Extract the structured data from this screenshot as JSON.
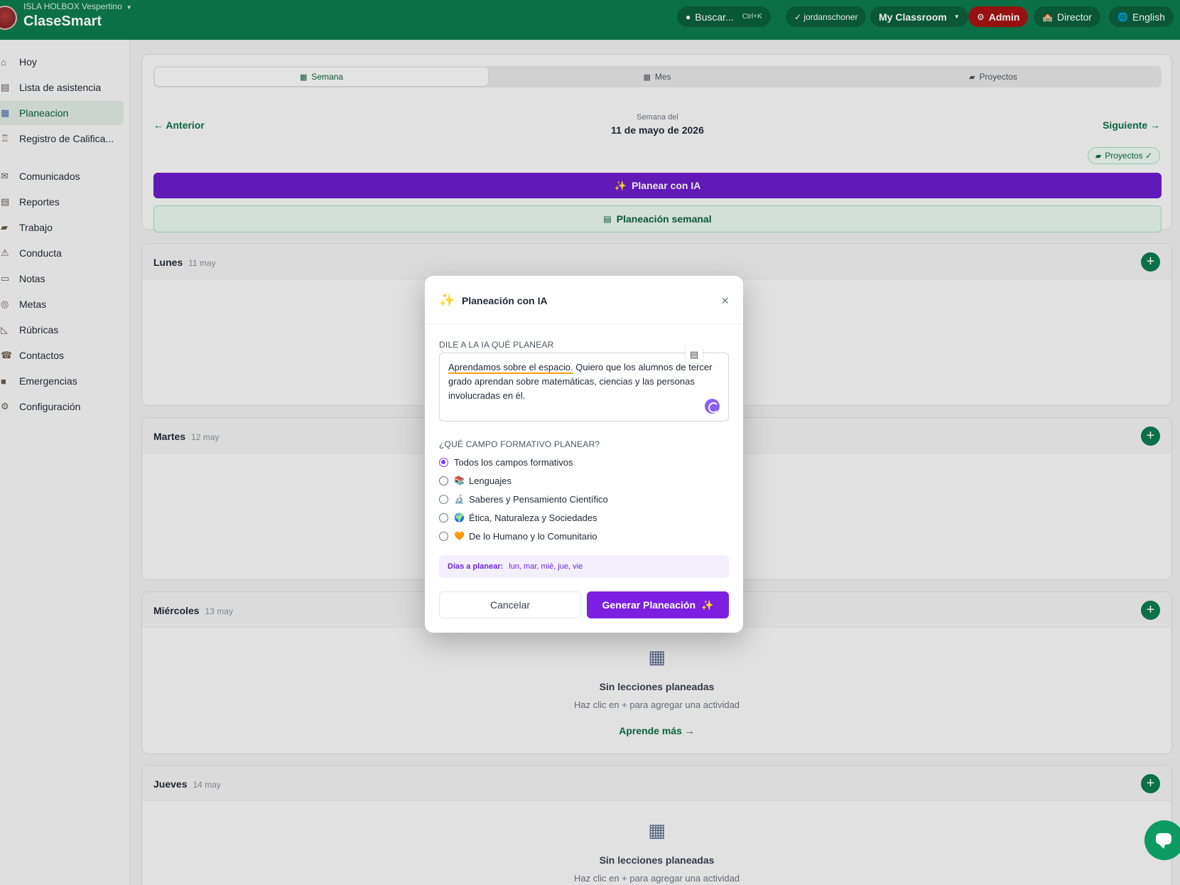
{
  "header": {
    "school": "ISLA HOLBOX Vespertino",
    "brand": "ClaseSmart",
    "search": {
      "label": "Buscar...",
      "shortcut": "Ctrl+K"
    },
    "user": "✓ jordanschoner",
    "classroom": "My Classroom",
    "admin": "Admin",
    "director": "Director",
    "language": "English"
  },
  "sidebar": {
    "items": [
      {
        "label": "Hoy",
        "icon": "house-icon"
      },
      {
        "label": "Lista de asistencia",
        "icon": "clipboard-icon"
      },
      {
        "label": "Planeacion",
        "icon": "calendar-icon",
        "active": true
      },
      {
        "label": "Registro de Califica...",
        "icon": "trophy-icon"
      },
      {
        "label": "Comunicados",
        "icon": "mailbox-icon"
      },
      {
        "label": "Reportes",
        "icon": "report-icon"
      },
      {
        "label": "Trabajo",
        "icon": "folder-icon"
      },
      {
        "label": "Conducta",
        "icon": "warning-icon"
      },
      {
        "label": "Notas",
        "icon": "notes-icon"
      },
      {
        "label": "Metas",
        "icon": "target-icon"
      },
      {
        "label": "Rúbricas",
        "icon": "ruler-icon"
      },
      {
        "label": "Contactos",
        "icon": "phone-icon"
      },
      {
        "label": "Emergencias",
        "icon": "sos-icon"
      },
      {
        "label": "Configuración",
        "icon": "gear-icon"
      }
    ]
  },
  "planner": {
    "tabs": [
      "Semana",
      "Mes",
      "Proyectos"
    ],
    "prev": "← Anterior",
    "next": "Siguiente →",
    "week_label": "Semana del",
    "week_date": "11 de mayo de 2026",
    "projects_pill": "Proyectos ✓",
    "ai_button": "Planear con IA",
    "weekly_button": "Planeación semanal",
    "days": [
      {
        "name": "Lunes",
        "date": "11 may"
      },
      {
        "name": "Martes",
        "date": "12 may"
      },
      {
        "name": "Miércoles",
        "date": "13 may"
      },
      {
        "name": "Jueves",
        "date": "14 may"
      }
    ],
    "empty_title": "Sin lecciones planeadas",
    "empty_sub": "Haz clic en + para agregar una actividad",
    "learn_more": "Aprende más →"
  },
  "modal": {
    "title": "Planeación con IA",
    "prompt_label": "DILE A LA IA QUÉ PLANEAR",
    "prompt_highlight": "Aprendamos sobre el espacio.",
    "prompt_rest": " Quiero que los alumnos de tercer grado aprendan sobre matemáticas, ciencias y las personas involucradas en él.",
    "field_label": "¿QUÉ CAMPO FORMATIVO PLANEAR?",
    "options": [
      {
        "label": "Todos los campos formativos",
        "emoji": "",
        "checked": true
      },
      {
        "label": "Lenguajes",
        "emoji": "📚",
        "checked": false
      },
      {
        "label": "Saberes y Pensamiento Científico",
        "emoji": "🔬",
        "checked": false
      },
      {
        "label": "Ética, Naturaleza y Sociedades",
        "emoji": "🌍",
        "checked": false
      },
      {
        "label": "De lo Humano y lo Comunitario",
        "emoji": "🧡",
        "checked": false
      }
    ],
    "days_key": "Días a planear:",
    "days_value": "lun, mar, mié, jue, vie",
    "cancel": "Cancelar",
    "generate": "Generar Planeación"
  }
}
